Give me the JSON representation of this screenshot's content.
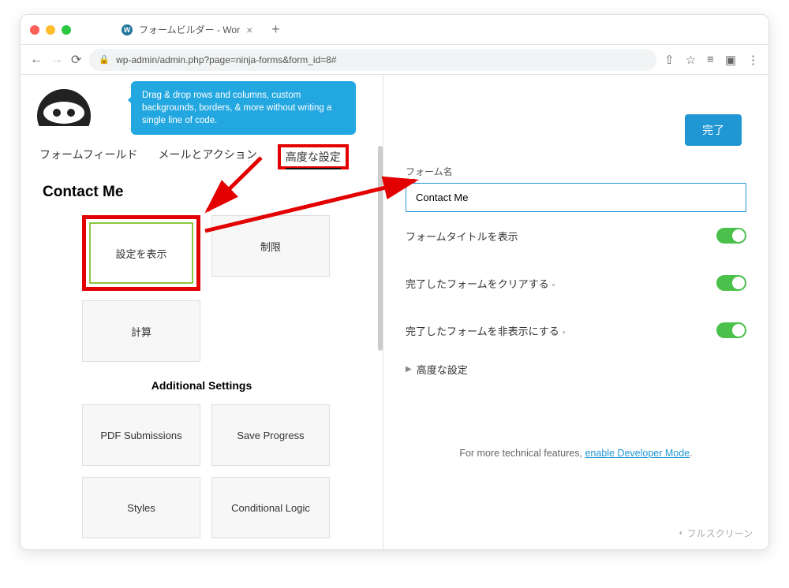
{
  "browser": {
    "tab_title": "フォームビルダー - Wor",
    "url": "wp-admin/admin.php?page=ninja-forms&form_id=8#"
  },
  "tooltip": "Drag & drop rows and columns, custom backgrounds, borders, & more without writing a single line of code.",
  "tabs": {
    "fields": "フォームフィールド",
    "emails": "メールとアクション",
    "advanced": "高度な設定"
  },
  "form_title_left": "Contact Me",
  "cards": {
    "display": "設定を表示",
    "restrict": "制限",
    "calc": "計算"
  },
  "addl_title": "Additional Settings",
  "addl_cards": {
    "pdf": "PDF Submissions",
    "save": "Save Progress",
    "styles": "Styles",
    "cond": "Conditional Logic"
  },
  "done": "完了",
  "right": {
    "form_name_label": "フォーム名",
    "form_name_value": "Contact Me",
    "show_title": "フォームタイトルを表示",
    "clear": "完了したフォームをクリアする",
    "hide": "完了したフォームを非表示にする",
    "adv": "高度な設定",
    "dev_pre": "For more technical features, ",
    "dev_link": "enable Developer Mode",
    "dev_post": "."
  },
  "fullscreen": "フルスクリーン"
}
